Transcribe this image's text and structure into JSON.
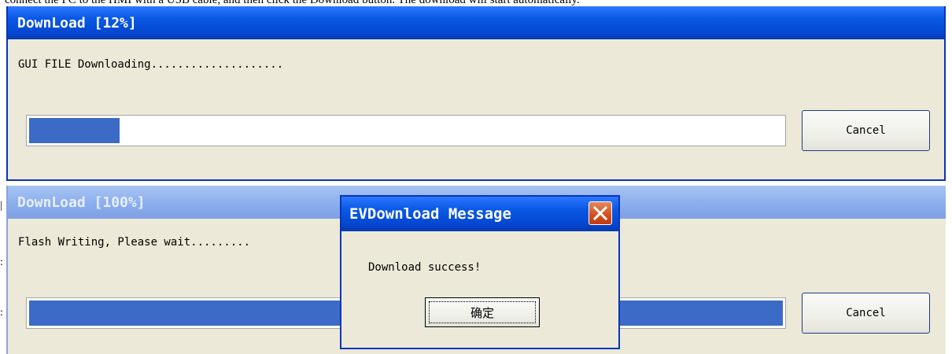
{
  "top_fragment": "connect the PC to the HMI with a USB cable, and then click the Download button. The download will start automatically.",
  "window1": {
    "title": "DownLoad [12%]",
    "message": "GUI FILE Downloading....................",
    "progress_percent": 12,
    "cancel_label": "Cancel"
  },
  "window2": {
    "title": "DownLoad [100%]",
    "message": "Flash Writing, Please wait.........",
    "progress_percent": 100,
    "cancel_label": "Cancel"
  },
  "dialog": {
    "title": "EVDownload Message",
    "message": "Download success!",
    "ok_label": "确定"
  },
  "colors": {
    "titlebar_active": "#0a5ae6",
    "titlebar_inactive": "#8db0ee",
    "progress_fill": "#3c6ac7",
    "window_face": "#ece9d8",
    "close_button": "#d64d1c"
  }
}
